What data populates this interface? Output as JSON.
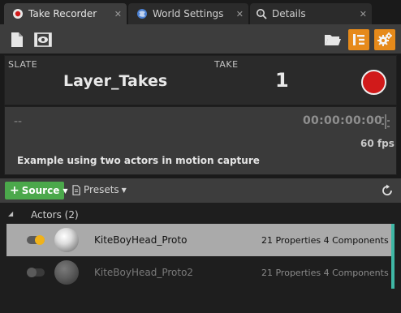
{
  "tabs": [
    {
      "label": "Take Recorder",
      "icon": "record-icon",
      "active": true
    },
    {
      "label": "World Settings",
      "icon": "globe-icon",
      "active": false
    },
    {
      "label": "Details",
      "icon": "details-magnifier-icon",
      "active": false
    }
  ],
  "toolbar": {
    "left_icons": [
      "new-document-icon",
      "review-eye-icon"
    ],
    "right_icons": [
      "open-folder-icon",
      "sequence-tree-icon",
      "settings-gear-icon"
    ]
  },
  "slate": {
    "label": "SLATE",
    "value": "Layer_Takes"
  },
  "take": {
    "label": "TAKE",
    "value": "1"
  },
  "timecode": {
    "placeholder": "--",
    "time": "00:00:00:00",
    "fps": "60 fps",
    "description": "Example using two actors in motion capture"
  },
  "sources": {
    "source_label": "Source",
    "presets_label": "Presets"
  },
  "group": {
    "label": "Actors (2)"
  },
  "actors": [
    {
      "name": "KiteBoyHead_Proto",
      "info": "21 Properties 4 Components",
      "enabled": true,
      "selected": true
    },
    {
      "name": "KiteBoyHead_Proto2",
      "info": "21 Properties 4 Components",
      "enabled": false,
      "selected": false
    }
  ],
  "colors": {
    "accent_orange": "#e68a1a",
    "record_red": "#d11a1a",
    "source_green": "#4ba84b",
    "toggle_yellow": "#f0b21a",
    "selection_teal": "#3fb7a5"
  }
}
